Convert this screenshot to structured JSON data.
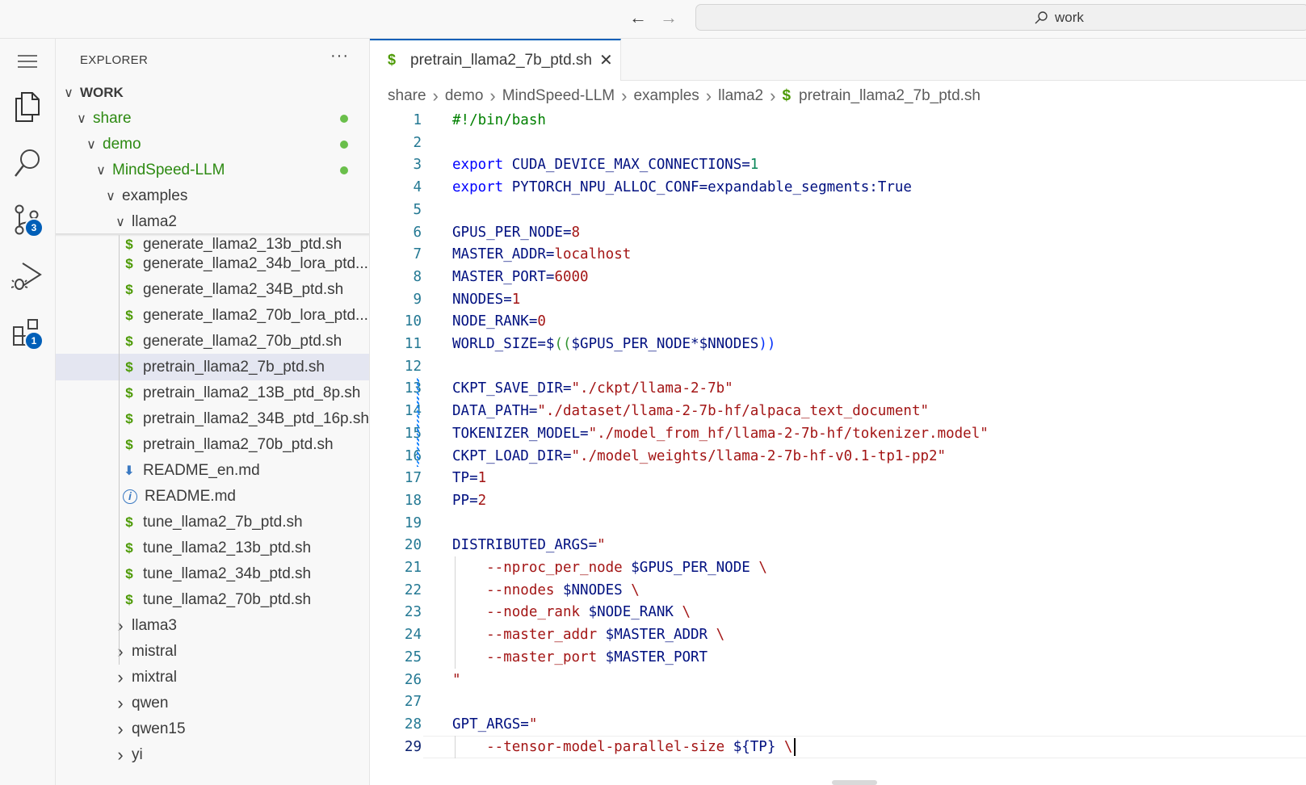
{
  "titlebar": {
    "back_icon": "arrow-left-icon",
    "forward_icon": "arrow-right-icon",
    "search_label": "work"
  },
  "activitybar": {
    "items": [
      {
        "name": "menu",
        "icon": "hamburger-icon"
      },
      {
        "name": "explorer",
        "icon": "files-icon"
      },
      {
        "name": "search",
        "icon": "search-icon"
      },
      {
        "name": "source-control",
        "icon": "source-control-icon",
        "badge": "3"
      },
      {
        "name": "run-debug",
        "icon": "run-debug-icon"
      },
      {
        "name": "extensions",
        "icon": "extensions-icon",
        "badge": "1"
      }
    ]
  },
  "sidebar": {
    "title": "EXPLORER",
    "more": "···",
    "tree": [
      {
        "label": "WORK",
        "type": "root",
        "expanded": true
      },
      {
        "label": "share",
        "type": "folder",
        "expanded": true,
        "modified": true
      },
      {
        "label": "demo",
        "type": "folder",
        "expanded": true,
        "modified": true
      },
      {
        "label": "MindSpeed-LLM",
        "type": "folder",
        "expanded": true,
        "modified": true
      },
      {
        "label": "examples",
        "type": "folder",
        "expanded": true
      },
      {
        "label": "llama2",
        "type": "folder",
        "expanded": true
      },
      {
        "label": "generate_llama2_13b_ptd.sh",
        "type": "sh"
      },
      {
        "label": "generate_llama2_34b_lora_ptd...",
        "type": "sh"
      },
      {
        "label": "generate_llama2_34B_ptd.sh",
        "type": "sh"
      },
      {
        "label": "generate_llama2_70b_lora_ptd...",
        "type": "sh"
      },
      {
        "label": "generate_llama2_70b_ptd.sh",
        "type": "sh"
      },
      {
        "label": "pretrain_llama2_7b_ptd.sh",
        "type": "sh",
        "selected": true
      },
      {
        "label": "pretrain_llama2_13B_ptd_8p.sh",
        "type": "sh"
      },
      {
        "label": "pretrain_llama2_34B_ptd_16p.sh",
        "type": "sh"
      },
      {
        "label": "pretrain_llama2_70b_ptd.sh",
        "type": "sh"
      },
      {
        "label": "README_en.md",
        "type": "md-download"
      },
      {
        "label": "README.md",
        "type": "md-info"
      },
      {
        "label": "tune_llama2_7b_ptd.sh",
        "type": "sh"
      },
      {
        "label": "tune_llama2_13b_ptd.sh",
        "type": "sh"
      },
      {
        "label": "tune_llama2_34b_ptd.sh",
        "type": "sh"
      },
      {
        "label": "tune_llama2_70b_ptd.sh",
        "type": "sh"
      },
      {
        "label": "llama3",
        "type": "folder",
        "expanded": false
      },
      {
        "label": "mistral",
        "type": "folder",
        "expanded": false
      },
      {
        "label": "mixtral",
        "type": "folder",
        "expanded": false
      },
      {
        "label": "qwen",
        "type": "folder",
        "expanded": false
      },
      {
        "label": "qwen15",
        "type": "folder",
        "expanded": false
      },
      {
        "label": "yi",
        "type": "folder",
        "expanded": false
      }
    ]
  },
  "editor": {
    "tab": {
      "label": "pretrain_llama2_7b_ptd.sh",
      "icon": "$",
      "close": "✕"
    },
    "breadcrumb": [
      "share",
      "demo",
      "MindSpeed-LLM",
      "examples",
      "llama2",
      "pretrain_llama2_7b_ptd.sh"
    ],
    "current_line": 29,
    "lines": [
      [
        [
          "cm",
          "#!/bin/bash"
        ]
      ],
      [],
      [
        [
          "kw",
          "export "
        ],
        [
          "var",
          "CUDA_DEVICE_MAX_CONNECTIONS"
        ],
        [
          "punc",
          "="
        ],
        [
          "num",
          "1"
        ]
      ],
      [
        [
          "kw",
          "export "
        ],
        [
          "var",
          "PYTORCH_NPU_ALLOC_CONF"
        ],
        [
          "punc",
          "=expandable_segments:True"
        ]
      ],
      [],
      [
        [
          "var",
          "GPUS_PER_NODE"
        ],
        [
          "punc",
          "="
        ],
        [
          "nr",
          "8"
        ]
      ],
      [
        [
          "var",
          "MASTER_ADDR"
        ],
        [
          "punc",
          "="
        ],
        [
          "nr",
          "localhost"
        ]
      ],
      [
        [
          "var",
          "MASTER_PORT"
        ],
        [
          "punc",
          "="
        ],
        [
          "nr",
          "6000"
        ]
      ],
      [
        [
          "var",
          "NNODES"
        ],
        [
          "punc",
          "="
        ],
        [
          "nr",
          "1"
        ]
      ],
      [
        [
          "var",
          "NODE_RANK"
        ],
        [
          "punc",
          "="
        ],
        [
          "nr",
          "0"
        ]
      ],
      [
        [
          "var",
          "WORLD_SIZE"
        ],
        [
          "punc",
          "=$"
        ],
        [
          "br",
          "(("
        ],
        [
          "var",
          "$GPUS_PER_NODE"
        ],
        [
          "punc",
          "*"
        ],
        [
          "var",
          "$NNODES"
        ],
        [
          "br2",
          "))"
        ]
      ],
      [],
      [
        [
          "var",
          "CKPT_SAVE_DIR"
        ],
        [
          "punc",
          "="
        ],
        [
          "str",
          "\"./ckpt/llama-2-7b\""
        ]
      ],
      [
        [
          "var",
          "DATA_PATH"
        ],
        [
          "punc",
          "="
        ],
        [
          "str",
          "\"./dataset/llama-2-7b-hf/alpaca_text_document\""
        ]
      ],
      [
        [
          "var",
          "TOKENIZER_MODEL"
        ],
        [
          "punc",
          "="
        ],
        [
          "str",
          "\"./model_from_hf/llama-2-7b-hf/tokenizer.model\""
        ]
      ],
      [
        [
          "var",
          "CKPT_LOAD_DIR"
        ],
        [
          "punc",
          "="
        ],
        [
          "str",
          "\"./model_weights/llama-2-7b-hf-v0.1-tp1-pp2\""
        ]
      ],
      [
        [
          "var",
          "TP"
        ],
        [
          "punc",
          "="
        ],
        [
          "nr",
          "1"
        ]
      ],
      [
        [
          "var",
          "PP"
        ],
        [
          "punc",
          "="
        ],
        [
          "nr",
          "2"
        ]
      ],
      [],
      [
        [
          "var",
          "DISTRIBUTED_ARGS"
        ],
        [
          "punc",
          "="
        ],
        [
          "str",
          "\""
        ]
      ],
      [
        [
          "str",
          "    --nproc_per_node "
        ],
        [
          "var",
          "$GPUS_PER_NODE"
        ],
        [
          "str",
          " \\"
        ]
      ],
      [
        [
          "str",
          "    --nnodes "
        ],
        [
          "var",
          "$NNODES"
        ],
        [
          "str",
          " \\"
        ]
      ],
      [
        [
          "str",
          "    --node_rank "
        ],
        [
          "var",
          "$NODE_RANK"
        ],
        [
          "str",
          " \\"
        ]
      ],
      [
        [
          "str",
          "    --master_addr "
        ],
        [
          "var",
          "$MASTER_ADDR"
        ],
        [
          "str",
          " \\"
        ]
      ],
      [
        [
          "str",
          "    --master_port "
        ],
        [
          "var",
          "$MASTER_PORT"
        ]
      ],
      [
        [
          "str",
          "\""
        ]
      ],
      [],
      [
        [
          "var",
          "GPT_ARGS"
        ],
        [
          "punc",
          "="
        ],
        [
          "str",
          "\""
        ]
      ],
      [
        [
          "str",
          "    --tensor-model-parallel-size "
        ],
        [
          "var",
          "${TP}"
        ],
        [
          "str",
          " \\"
        ]
      ]
    ]
  }
}
